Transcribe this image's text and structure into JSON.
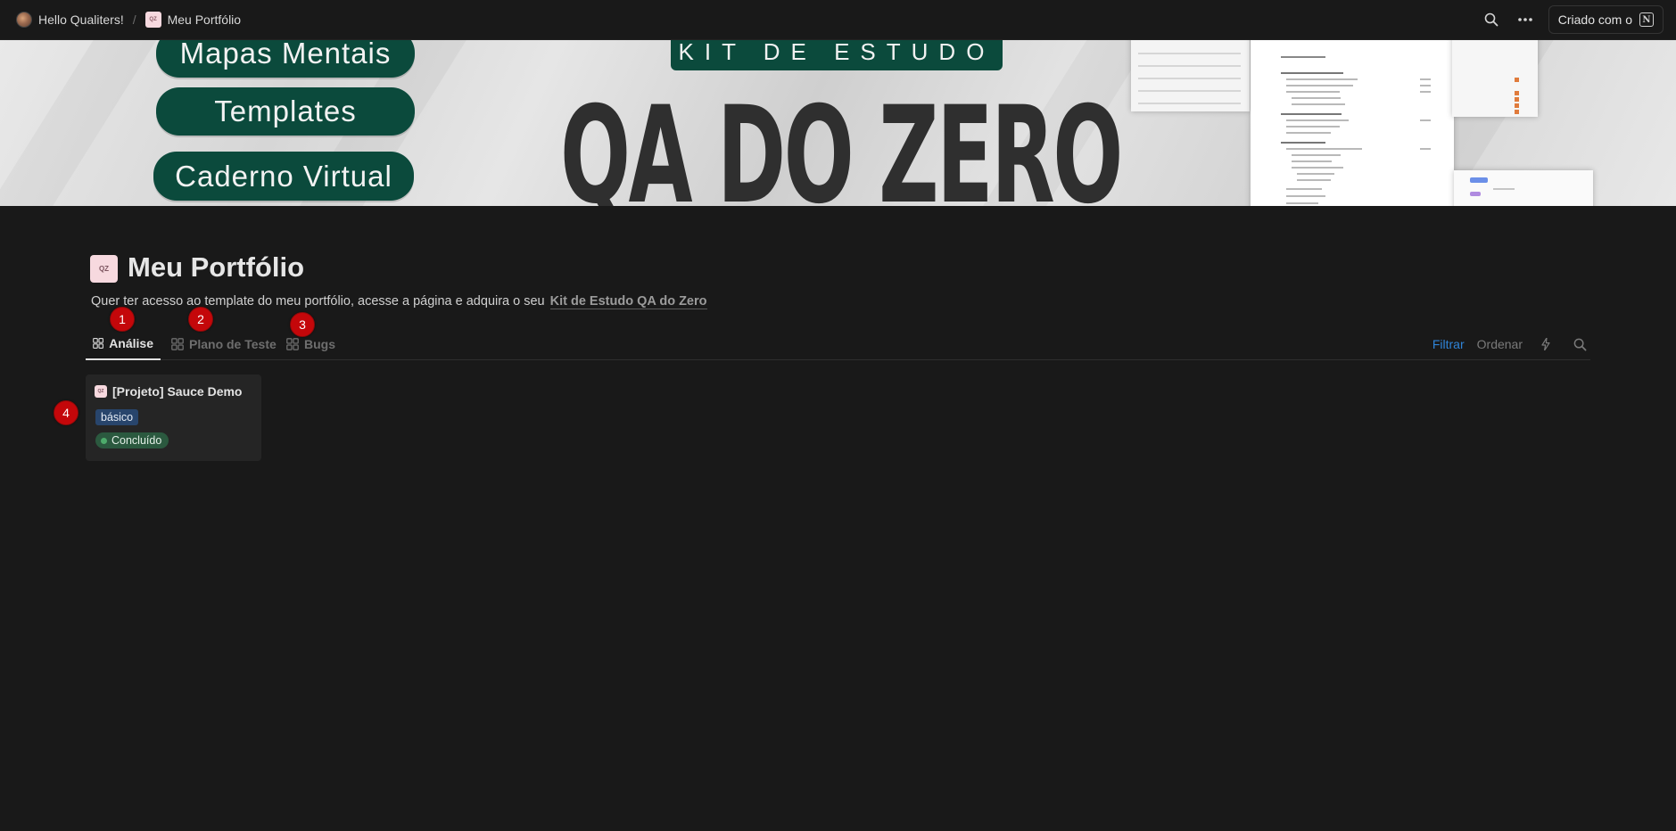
{
  "breadcrumb": {
    "workspace": "Hello Qualiters!",
    "separator": "/",
    "current": "Meu Portfólio"
  },
  "topbar": {
    "search_icon": "search-icon",
    "more_icon": "more-horizontal-icon",
    "made_with_label": "Criado com o",
    "notion_logo_letter": "N"
  },
  "cover": {
    "pills": [
      "Mapas Mentais",
      "Templates",
      "Caderno Virtual"
    ],
    "kit_banner": "KIT DE ESTUDO",
    "title": "QA DO ZERO",
    "colors": {
      "pill_green": "#0b4a3c",
      "title_dark": "#2f2f2f"
    }
  },
  "page": {
    "icon_text": "QZ",
    "title": "Meu Portfólio",
    "description": "Quer ter acesso ao template do meu portfólio, acesse a página e adquira o seu",
    "link_text": "Kit de Estudo QA do Zero"
  },
  "tabs": [
    {
      "label": "Análise",
      "active": true
    },
    {
      "label": "Plano de Teste",
      "active": false
    },
    {
      "label": "Bugs",
      "active": false
    }
  ],
  "view_actions": {
    "filter": "Filtrar",
    "sort": "Ordenar",
    "automation_icon": "lightning-icon",
    "search_icon": "search-icon",
    "filter_color": "#2f83d6"
  },
  "card": {
    "title": "[Projeto] Sauce Demo",
    "tag": "básico",
    "status": "Concluído",
    "colors": {
      "tag_bg": "#28456c",
      "status_bg": "#2b593f",
      "status_dot": "#4dab6b"
    }
  },
  "markers": [
    "1",
    "2",
    "3",
    "4"
  ]
}
